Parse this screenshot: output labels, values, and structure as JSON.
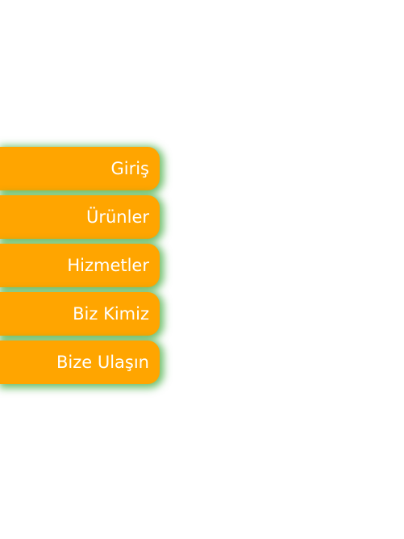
{
  "menu": {
    "items": [
      {
        "label": "Giriş"
      },
      {
        "label": "Ürünler"
      },
      {
        "label": "Hizmetler"
      },
      {
        "label": "Biz Kimiz"
      },
      {
        "label": "Bize Ulaşın"
      }
    ]
  },
  "colors": {
    "button_bg": "#ffa500",
    "button_text": "#ffffff",
    "glow": "#3eaa3a",
    "page_bg": "#ffffff"
  }
}
